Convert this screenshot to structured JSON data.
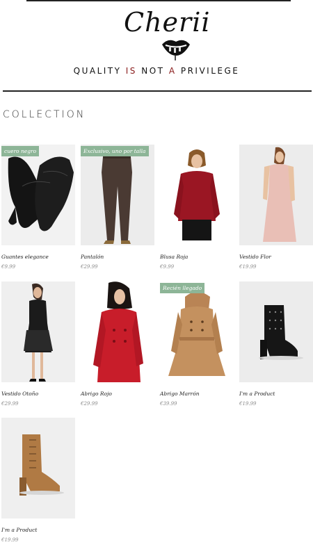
{
  "brand": {
    "logo_text": "Cherii",
    "tagline_parts": [
      "QUALITY ",
      "IS",
      " NOT ",
      "A",
      " PRIVILEGE"
    ]
  },
  "section": {
    "title": "COLLECTION"
  },
  "products": [
    {
      "name": "Guantes elegance",
      "price": "€9.99",
      "badge": "cuero negro",
      "icon": "black-gloves-icon"
    },
    {
      "name": "Pantalón",
      "price": "€29.99",
      "badge": "Exclusivo, uno por talla",
      "icon": "brown-trousers-icon"
    },
    {
      "name": "Blusa Roja",
      "price": "€9.99",
      "badge": "",
      "icon": "red-blouse-icon"
    },
    {
      "name": "Vestido Flor",
      "price": "€19.99",
      "badge": "",
      "icon": "pink-lace-dress-icon"
    },
    {
      "name": "Vestido Otoño",
      "price": "€29.99",
      "badge": "",
      "icon": "black-dress-icon"
    },
    {
      "name": "Abrigo Rojo",
      "price": "€29.99",
      "badge": "",
      "icon": "red-coat-icon"
    },
    {
      "name": "Abrigo Marrón",
      "price": "€39.99",
      "badge": "Recién llegado",
      "icon": "camel-coat-icon"
    },
    {
      "name": "I'm a Product",
      "price": "€19.99",
      "badge": "",
      "icon": "black-studded-boot-icon"
    },
    {
      "name": "I'm a Product",
      "price": "€19.99",
      "badge": "",
      "icon": "tan-laceup-boot-icon"
    }
  ],
  "colors": {
    "badge": "#8db597",
    "accent": "#8a1c1c",
    "price": "#888888"
  }
}
